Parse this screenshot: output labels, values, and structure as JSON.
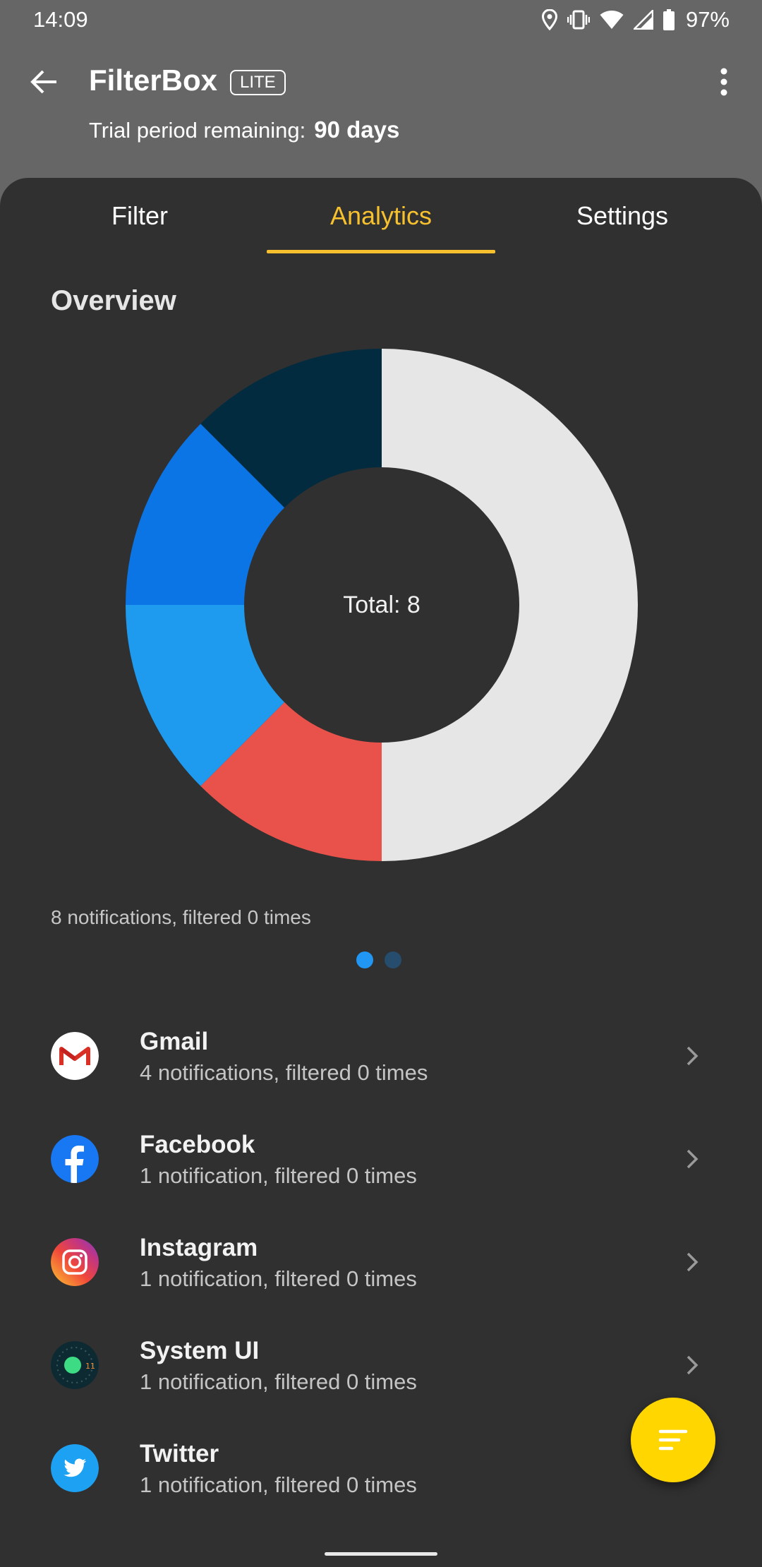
{
  "status_bar": {
    "time": "14:09",
    "battery": "97%",
    "icons": [
      "location-icon",
      "vibrate-icon",
      "wifi-icon",
      "signal-icon",
      "battery-icon"
    ]
  },
  "app_bar": {
    "title": "FilterBox",
    "badge": "LITE",
    "trial_label": "Trial period remaining:",
    "trial_days": "90 days"
  },
  "tabs": [
    {
      "label": "Filter",
      "selected": false
    },
    {
      "label": "Analytics",
      "selected": true
    },
    {
      "label": "Settings",
      "selected": false
    }
  ],
  "overview": {
    "title": "Overview",
    "center_label": "Total: 8",
    "summary": "8 notifications, filtered 0 times",
    "page_index": 0,
    "page_count": 2
  },
  "chart_data": {
    "type": "pie",
    "donut": true,
    "title": "",
    "total": 8,
    "slices": [
      {
        "label": "Gmail",
        "value": 4,
        "color": "#e6e6e6"
      },
      {
        "label": "Facebook",
        "value": 1,
        "color": "#e8524a"
      },
      {
        "label": "Instagram",
        "value": 1,
        "color": "#1e9bee"
      },
      {
        "label": "System UI",
        "value": 1,
        "color": "#0b75e6"
      },
      {
        "label": "Twitter",
        "value": 1,
        "color": "#032b40"
      }
    ]
  },
  "apps": [
    {
      "name": "Gmail",
      "subtitle": "4 notifications, filtered 0 times",
      "icon": "gmail-icon"
    },
    {
      "name": "Facebook",
      "subtitle": "1 notification, filtered 0 times",
      "icon": "facebook-icon"
    },
    {
      "name": "Instagram",
      "subtitle": "1 notification, filtered 0 times",
      "icon": "instagram-icon"
    },
    {
      "name": "System UI",
      "subtitle": "1 notification, filtered 0 times",
      "icon": "system-ui-icon"
    },
    {
      "name": "Twitter",
      "subtitle": "1 notification, filtered 0 times",
      "icon": "twitter-icon"
    }
  ],
  "colors": {
    "accent": "#f6c02e",
    "fab": "#ffd600",
    "background": "#303030",
    "header": "#666666"
  }
}
